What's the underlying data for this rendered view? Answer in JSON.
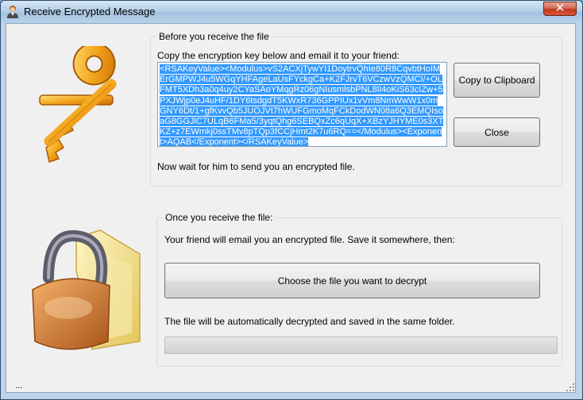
{
  "window": {
    "title": "Receive Encrypted Message",
    "close_glyph": "✕"
  },
  "before": {
    "group_title": "Before you receive the file",
    "instruction": "Copy the encryption key below and email it to your friend:",
    "key_text": "<RSAKeyValue><Modulus>vS2ACXjTywYI1DoytrvQhIe80R8CqvbtHoIMErGMPWJ4u5WGqYHFAgeLaUsFYckgCa+K2FJrvT6VCzwVzQMCI/+OLFMT5XDh3a0q4uy2CYaSAoYMqgRz06gNIusmlsbPNL8lI4oKiS63cIZw+5PXJWjp0eJ4uHF/1DY6tsdgdT5KWxR736GPPIUx1vVm8NmWwW1x0mGNY6Dt/1+gfKvvQb5JUOJVt7hWUFGmoMqFCkDodWN08a6Q3EMQIsoaG8GGJlC7ULqB6FMa5/3yqtQhg6SEBQxZc6qUqX+XBzYJHYME0s3XTKZ+z7EWmkj0ssTMv8pTQp3fCCjHmt2K7u6RQ==</Modulus><Exponent>AQAB</Exponent></RSAKeyValue>",
    "copy_button": "Copy to Clipboard",
    "close_button": "Close",
    "wait_text": "Now wait for him to send you an encrypted file."
  },
  "once": {
    "group_title": "Once you receive the file:",
    "instruction": "Your friend will email you an encrypted file. Save it somewhere, then:",
    "choose_button": "Choose the file you want to decrypt",
    "auto_text": "The file will be automatically decrypted and saved in the same folder.",
    "progress": 0
  },
  "status_text": "...",
  "icons": {
    "title": "user-icon",
    "key": "key-icon",
    "folder_lock": "locked-folder-icon"
  },
  "colors": {
    "selection": "#3399ff",
    "close_button": "#c0381e"
  }
}
